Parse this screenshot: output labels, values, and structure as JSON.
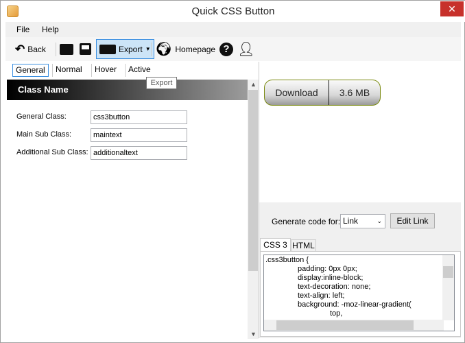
{
  "window": {
    "title": "Quick CSS Button",
    "close": "✕"
  },
  "menu": [
    "File",
    "Help"
  ],
  "toolbar": {
    "back": "Back",
    "export": "Export",
    "homepage": "Homepage",
    "tooltip": "Export"
  },
  "tabs": [
    "General",
    "Normal",
    "Hover",
    "Active"
  ],
  "section_header": "Class Name",
  "fields": [
    {
      "label": "General Class:",
      "value": "css3button"
    },
    {
      "label": "Main Sub Class:",
      "value": "maintext"
    },
    {
      "label": "Additional Sub Class:",
      "value": "additionaltext"
    }
  ],
  "preview": {
    "label": "Download",
    "size": "3.6 MB"
  },
  "generate": {
    "label": "Generate code for:",
    "selected": "Link",
    "edit_button": "Edit Link"
  },
  "code_tabs": [
    "CSS 3",
    "HTML"
  ],
  "code_lines": [
    ".css3button {",
    "padding: 0px 0px;",
    "display:inline-block;",
    "text-decoration: none;",
    "text-align: left;",
    "background: -moz-linear-gradient(",
    "top,"
  ]
}
